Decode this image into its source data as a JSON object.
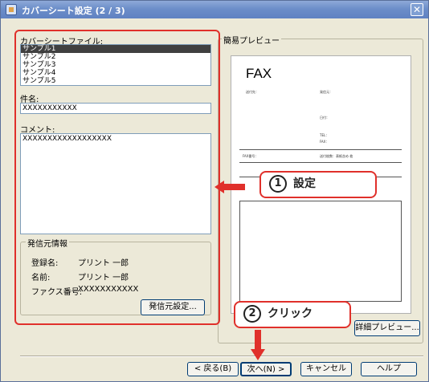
{
  "window": {
    "title": "カバーシート設定 (2 / 3)",
    "close_glyph": "✕"
  },
  "left": {
    "file_label": "カバーシートファイル:",
    "files": [
      "サンプル1",
      "サンプル2",
      "サンプル3",
      "サンプル4",
      "サンプル5"
    ],
    "subject_label": "件名:",
    "subject_value": "XXXXXXXXXXX",
    "comment_label": "コメント:",
    "comment_value": "XXXXXXXXXXXXXXXXXX",
    "sender_group_label": "発信元情報",
    "sender_name_label": "登録名:",
    "sender_name_value": "プリント 一郎",
    "name_label": "名前:",
    "name_value": "プリント 一郎",
    "fax_label": "ファクス番号:",
    "fax_value": "XXXXXXXXXXX",
    "sender_settings_button": "発信元設定..."
  },
  "preview": {
    "group_label": "簡易プレビュー",
    "fax_heading": "FAX",
    "to_label": "送付先：",
    "from_label": "発信元：",
    "date_label": "日付：",
    "tel_label": "TEL：",
    "fax_small_label": "FAX：",
    "fax_number_label": "FAX番号：",
    "pages_label": "送付枚数：表紙含め  枚",
    "detail_button": "詳細プレビュー..."
  },
  "footer": {
    "back_button": "< 戻る(B)",
    "next_button": "次へ(N) >",
    "cancel_button": "キャンセル",
    "help_button": "ヘルプ"
  },
  "annotations": {
    "step1_number": "1",
    "step1_text": "設定",
    "step2_number": "2",
    "step2_text": "クリック",
    "accent_color": "#e0302b"
  }
}
